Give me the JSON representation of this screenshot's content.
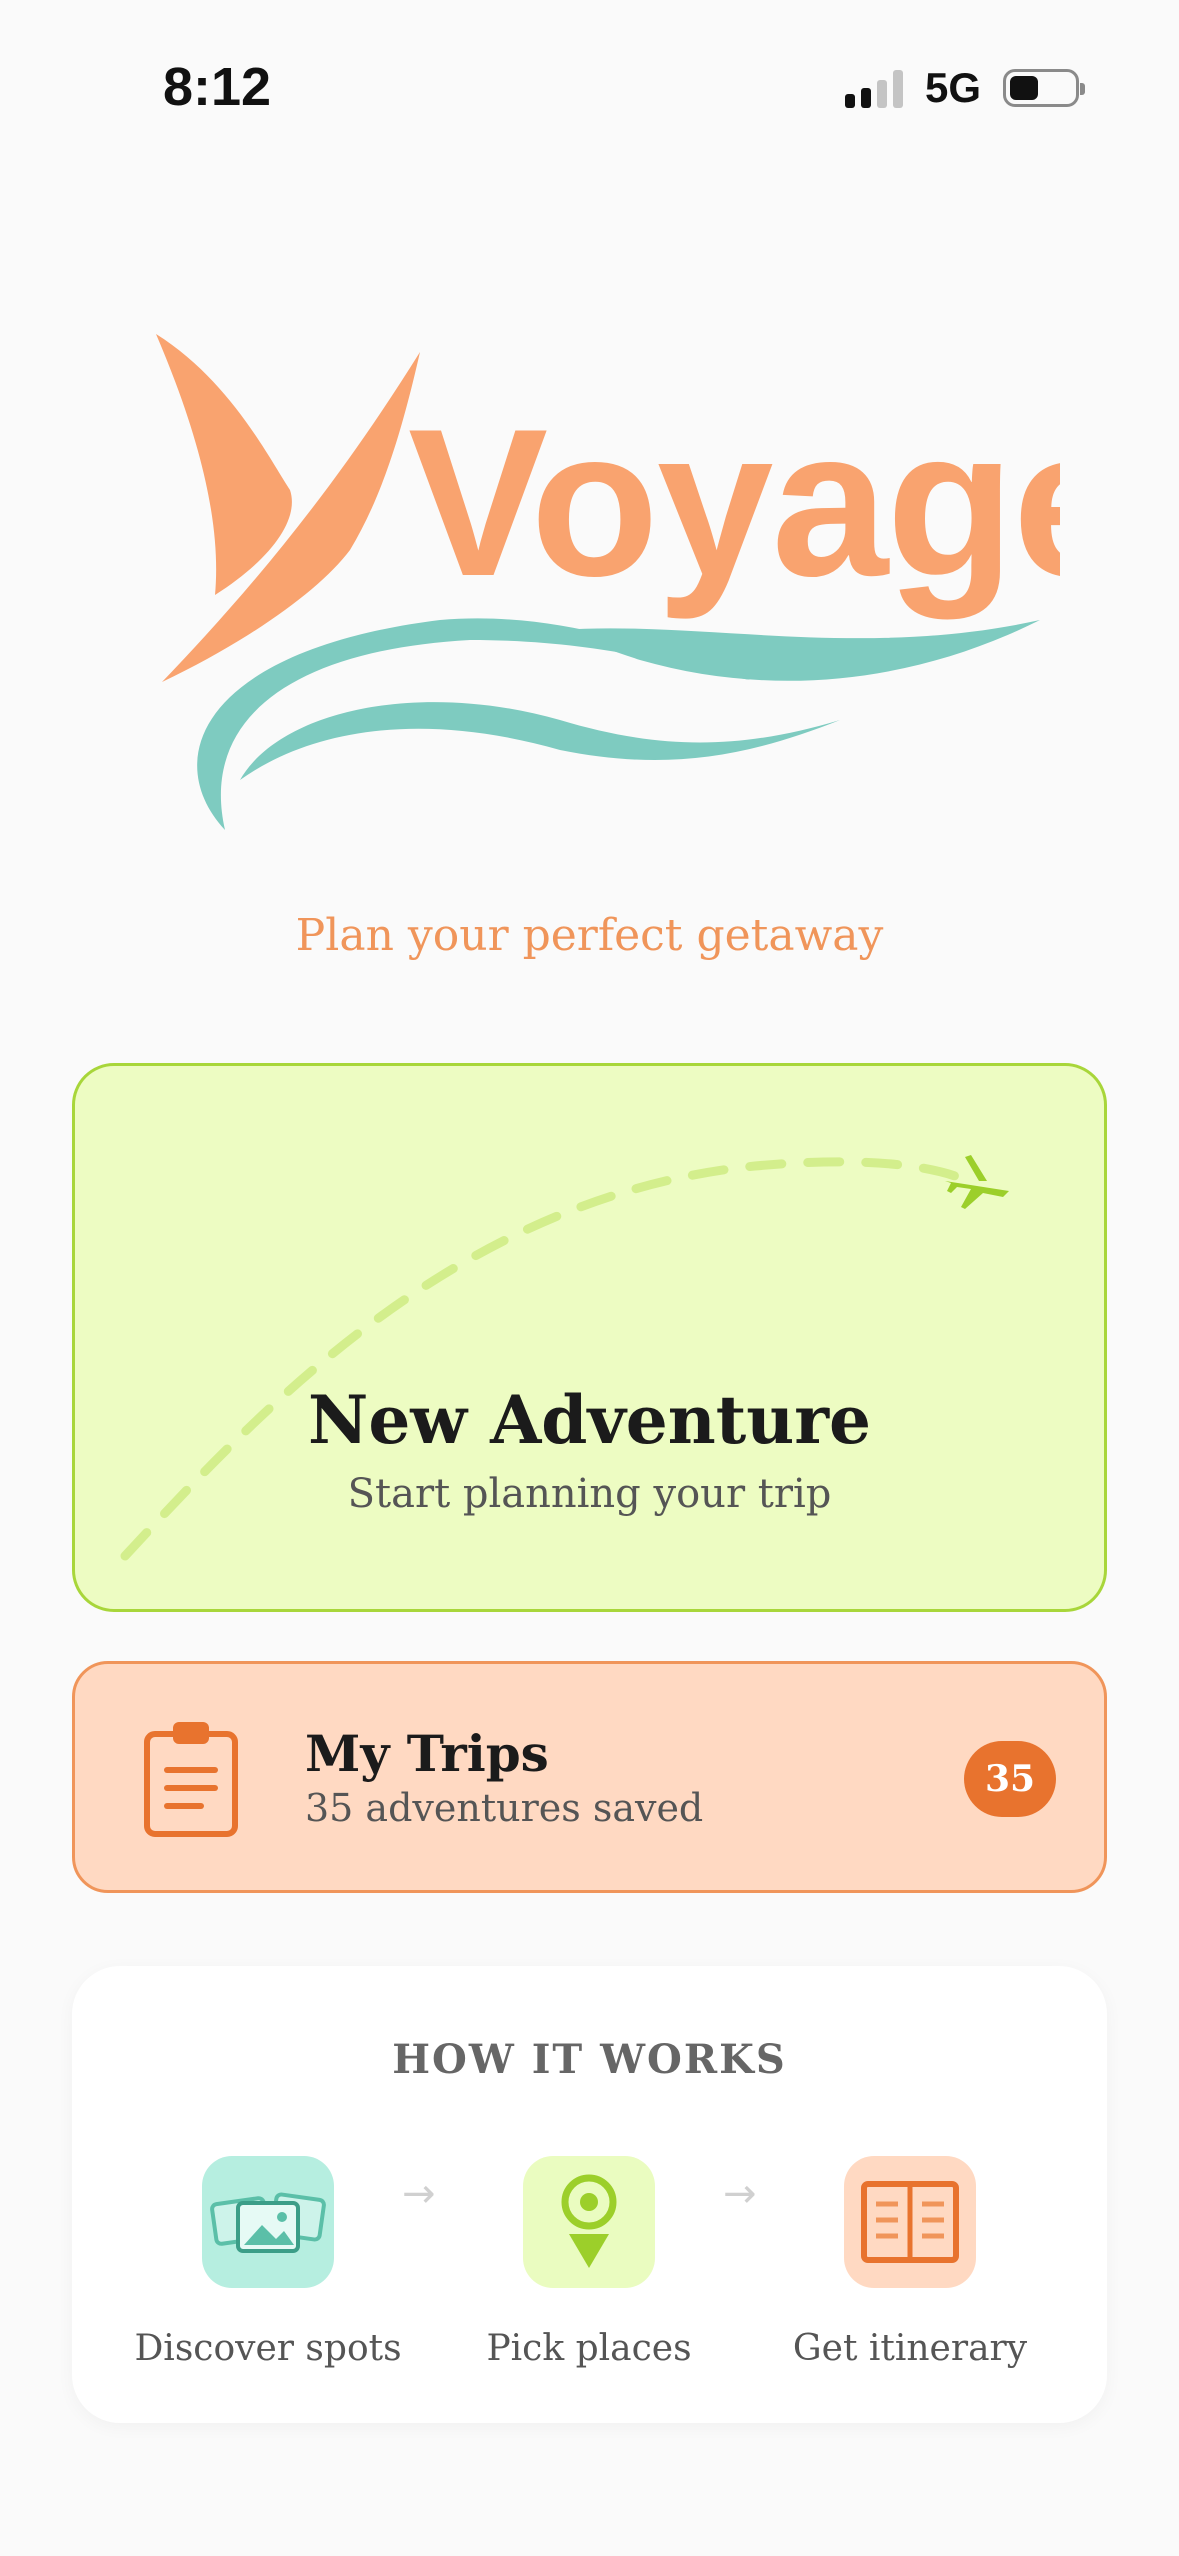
{
  "status_bar": {
    "time": "8:12",
    "network": "5G"
  },
  "app": {
    "logo_text": "Voyage",
    "tagline": "Plan your perfect getaway",
    "colors": {
      "orange": "#f9a36f",
      "teal": "#7ecbc0",
      "lime": "#a8d63a",
      "accent": "#e8732e"
    }
  },
  "new_adventure": {
    "title": "New Adventure",
    "subtitle": "Start planning your trip",
    "icon": "plane-icon"
  },
  "my_trips": {
    "title": "My Trips",
    "subtitle": "35 adventures saved",
    "badge": "35",
    "icon": "clipboard-icon"
  },
  "how_it_works": {
    "title": "HOW IT WORKS",
    "steps": [
      {
        "label": "Discover spots",
        "icon": "photos-icon"
      },
      {
        "label": "Pick places",
        "icon": "map-pin-icon"
      },
      {
        "label": "Get itinerary",
        "icon": "itinerary-book-icon"
      }
    ],
    "arrow": "→"
  }
}
